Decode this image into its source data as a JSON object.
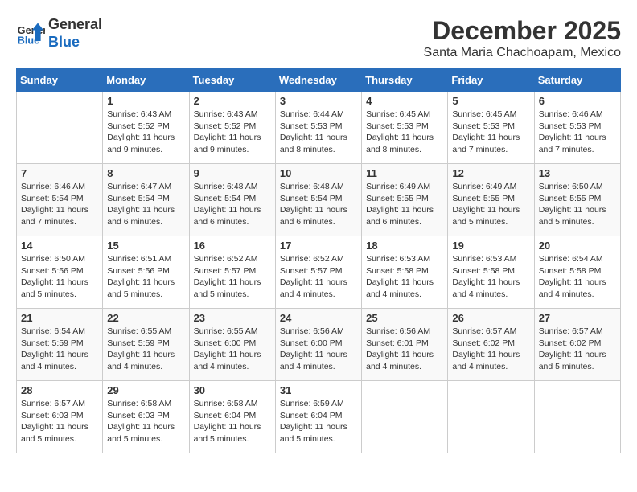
{
  "header": {
    "logo_line1": "General",
    "logo_line2": "Blue",
    "month": "December 2025",
    "location": "Santa Maria Chachoapam, Mexico"
  },
  "weekdays": [
    "Sunday",
    "Monday",
    "Tuesday",
    "Wednesday",
    "Thursday",
    "Friday",
    "Saturday"
  ],
  "weeks": [
    [
      {
        "day": "",
        "sunrise": "",
        "sunset": "",
        "daylight": ""
      },
      {
        "day": "1",
        "sunrise": "Sunrise: 6:43 AM",
        "sunset": "Sunset: 5:52 PM",
        "daylight": "Daylight: 11 hours and 9 minutes."
      },
      {
        "day": "2",
        "sunrise": "Sunrise: 6:43 AM",
        "sunset": "Sunset: 5:52 PM",
        "daylight": "Daylight: 11 hours and 9 minutes."
      },
      {
        "day": "3",
        "sunrise": "Sunrise: 6:44 AM",
        "sunset": "Sunset: 5:53 PM",
        "daylight": "Daylight: 11 hours and 8 minutes."
      },
      {
        "day": "4",
        "sunrise": "Sunrise: 6:45 AM",
        "sunset": "Sunset: 5:53 PM",
        "daylight": "Daylight: 11 hours and 8 minutes."
      },
      {
        "day": "5",
        "sunrise": "Sunrise: 6:45 AM",
        "sunset": "Sunset: 5:53 PM",
        "daylight": "Daylight: 11 hours and 7 minutes."
      },
      {
        "day": "6",
        "sunrise": "Sunrise: 6:46 AM",
        "sunset": "Sunset: 5:53 PM",
        "daylight": "Daylight: 11 hours and 7 minutes."
      }
    ],
    [
      {
        "day": "7",
        "sunrise": "Sunrise: 6:46 AM",
        "sunset": "Sunset: 5:54 PM",
        "daylight": "Daylight: 11 hours and 7 minutes."
      },
      {
        "day": "8",
        "sunrise": "Sunrise: 6:47 AM",
        "sunset": "Sunset: 5:54 PM",
        "daylight": "Daylight: 11 hours and 6 minutes."
      },
      {
        "day": "9",
        "sunrise": "Sunrise: 6:48 AM",
        "sunset": "Sunset: 5:54 PM",
        "daylight": "Daylight: 11 hours and 6 minutes."
      },
      {
        "day": "10",
        "sunrise": "Sunrise: 6:48 AM",
        "sunset": "Sunset: 5:54 PM",
        "daylight": "Daylight: 11 hours and 6 minutes."
      },
      {
        "day": "11",
        "sunrise": "Sunrise: 6:49 AM",
        "sunset": "Sunset: 5:55 PM",
        "daylight": "Daylight: 11 hours and 6 minutes."
      },
      {
        "day": "12",
        "sunrise": "Sunrise: 6:49 AM",
        "sunset": "Sunset: 5:55 PM",
        "daylight": "Daylight: 11 hours and 5 minutes."
      },
      {
        "day": "13",
        "sunrise": "Sunrise: 6:50 AM",
        "sunset": "Sunset: 5:55 PM",
        "daylight": "Daylight: 11 hours and 5 minutes."
      }
    ],
    [
      {
        "day": "14",
        "sunrise": "Sunrise: 6:50 AM",
        "sunset": "Sunset: 5:56 PM",
        "daylight": "Daylight: 11 hours and 5 minutes."
      },
      {
        "day": "15",
        "sunrise": "Sunrise: 6:51 AM",
        "sunset": "Sunset: 5:56 PM",
        "daylight": "Daylight: 11 hours and 5 minutes."
      },
      {
        "day": "16",
        "sunrise": "Sunrise: 6:52 AM",
        "sunset": "Sunset: 5:57 PM",
        "daylight": "Daylight: 11 hours and 5 minutes."
      },
      {
        "day": "17",
        "sunrise": "Sunrise: 6:52 AM",
        "sunset": "Sunset: 5:57 PM",
        "daylight": "Daylight: 11 hours and 4 minutes."
      },
      {
        "day": "18",
        "sunrise": "Sunrise: 6:53 AM",
        "sunset": "Sunset: 5:58 PM",
        "daylight": "Daylight: 11 hours and 4 minutes."
      },
      {
        "day": "19",
        "sunrise": "Sunrise: 6:53 AM",
        "sunset": "Sunset: 5:58 PM",
        "daylight": "Daylight: 11 hours and 4 minutes."
      },
      {
        "day": "20",
        "sunrise": "Sunrise: 6:54 AM",
        "sunset": "Sunset: 5:58 PM",
        "daylight": "Daylight: 11 hours and 4 minutes."
      }
    ],
    [
      {
        "day": "21",
        "sunrise": "Sunrise: 6:54 AM",
        "sunset": "Sunset: 5:59 PM",
        "daylight": "Daylight: 11 hours and 4 minutes."
      },
      {
        "day": "22",
        "sunrise": "Sunrise: 6:55 AM",
        "sunset": "Sunset: 5:59 PM",
        "daylight": "Daylight: 11 hours and 4 minutes."
      },
      {
        "day": "23",
        "sunrise": "Sunrise: 6:55 AM",
        "sunset": "Sunset: 6:00 PM",
        "daylight": "Daylight: 11 hours and 4 minutes."
      },
      {
        "day": "24",
        "sunrise": "Sunrise: 6:56 AM",
        "sunset": "Sunset: 6:00 PM",
        "daylight": "Daylight: 11 hours and 4 minutes."
      },
      {
        "day": "25",
        "sunrise": "Sunrise: 6:56 AM",
        "sunset": "Sunset: 6:01 PM",
        "daylight": "Daylight: 11 hours and 4 minutes."
      },
      {
        "day": "26",
        "sunrise": "Sunrise: 6:57 AM",
        "sunset": "Sunset: 6:02 PM",
        "daylight": "Daylight: 11 hours and 4 minutes."
      },
      {
        "day": "27",
        "sunrise": "Sunrise: 6:57 AM",
        "sunset": "Sunset: 6:02 PM",
        "daylight": "Daylight: 11 hours and 5 minutes."
      }
    ],
    [
      {
        "day": "28",
        "sunrise": "Sunrise: 6:57 AM",
        "sunset": "Sunset: 6:03 PM",
        "daylight": "Daylight: 11 hours and 5 minutes."
      },
      {
        "day": "29",
        "sunrise": "Sunrise: 6:58 AM",
        "sunset": "Sunset: 6:03 PM",
        "daylight": "Daylight: 11 hours and 5 minutes."
      },
      {
        "day": "30",
        "sunrise": "Sunrise: 6:58 AM",
        "sunset": "Sunset: 6:04 PM",
        "daylight": "Daylight: 11 hours and 5 minutes."
      },
      {
        "day": "31",
        "sunrise": "Sunrise: 6:59 AM",
        "sunset": "Sunset: 6:04 PM",
        "daylight": "Daylight: 11 hours and 5 minutes."
      },
      {
        "day": "",
        "sunrise": "",
        "sunset": "",
        "daylight": ""
      },
      {
        "day": "",
        "sunrise": "",
        "sunset": "",
        "daylight": ""
      },
      {
        "day": "",
        "sunrise": "",
        "sunset": "",
        "daylight": ""
      }
    ]
  ]
}
